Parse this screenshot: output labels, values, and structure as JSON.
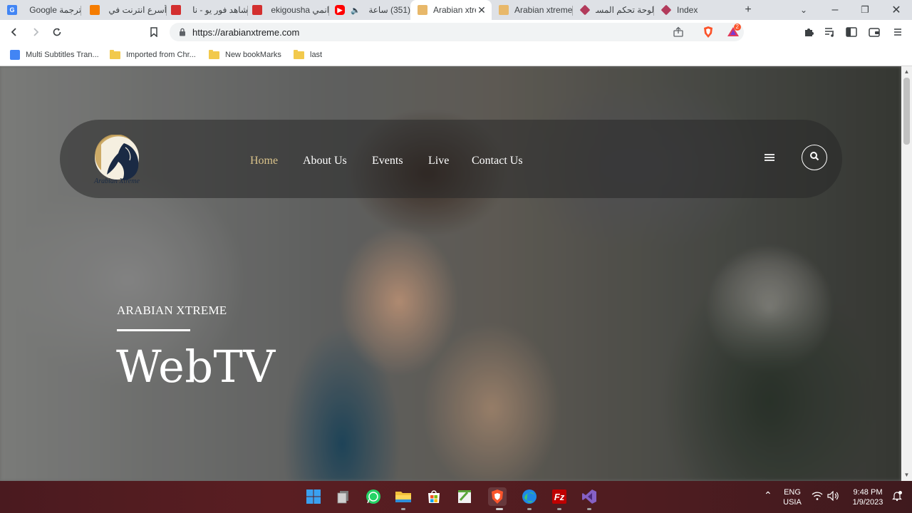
{
  "browser": {
    "tabs": [
      {
        "title": "ترجمة Google",
        "favicon": "google-translate-icon",
        "color": "#4285f4",
        "active": false
      },
      {
        "title": "أسرع انترنت في",
        "favicon": "orange-square-icon",
        "color": "#f57c00",
        "active": false
      },
      {
        "title": "شاهد فور يو - نا",
        "favicon": "red-tv-icon",
        "color": "#d32f2f",
        "active": false
      },
      {
        "title": "انمي ekigousha",
        "favicon": "red-tv-icon",
        "color": "#d32f2f",
        "active": false
      },
      {
        "title": "(351) ساعة",
        "favicon": "youtube-icon",
        "color": "#ff0000",
        "active": false,
        "audio": true
      },
      {
        "title": "Arabian xtre",
        "favicon": "arabian-xtreme-icon",
        "color": "#e8b86a",
        "active": true
      },
      {
        "title": "Arabian xtreme",
        "favicon": "arabian-xtreme-icon",
        "color": "#e8b86a",
        "active": false
      },
      {
        "title": "لوحة تحكم المسا",
        "favicon": "diamond-icon",
        "color": "#b23a5b",
        "active": false
      },
      {
        "title": "Index",
        "favicon": "diamond-icon",
        "color": "#b23a5b",
        "active": false
      }
    ],
    "url": "https://arabianxtreme.com",
    "bookmarks": [
      {
        "label": "Multi Subtitles Tran...",
        "type": "extension"
      },
      {
        "label": "Imported from Chr...",
        "type": "folder"
      },
      {
        "label": "New bookMarks",
        "type": "folder"
      },
      {
        "label": "last",
        "type": "folder"
      }
    ],
    "brave_badge": "2"
  },
  "site": {
    "logo_text": "Arabian Xtreme",
    "nav": [
      {
        "label": "Home",
        "active": true
      },
      {
        "label": "About Us",
        "active": false
      },
      {
        "label": "Events",
        "active": false
      },
      {
        "label": "Live",
        "active": false
      },
      {
        "label": "Contact Us",
        "active": false
      }
    ],
    "hero_eyebrow": "ARABIAN XTREME",
    "hero_title": "WebTV",
    "accent_color": "#d9c28a"
  },
  "taskbar": {
    "apps": [
      "windows-start-icon",
      "file-stack-icon",
      "whatsapp-icon",
      "file-explorer-icon",
      "microsoft-store-icon",
      "notepad-plus-icon",
      "brave-icon",
      "edge-icon",
      "filezilla-icon",
      "visual-studio-icon"
    ],
    "lang_top": "ENG",
    "lang_bottom": "USIA",
    "time": "9:48 PM",
    "date": "1/9/2023"
  }
}
